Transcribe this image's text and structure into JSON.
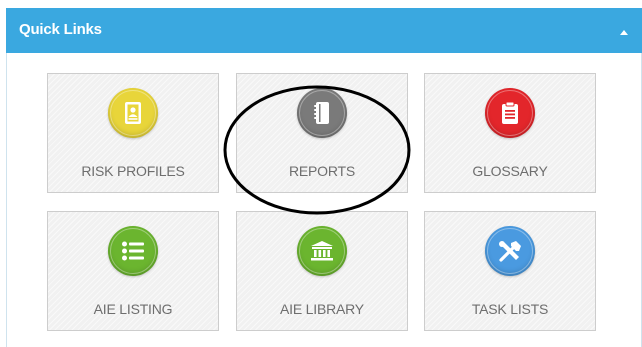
{
  "panel": {
    "title": "Quick Links",
    "collapse_icon": "chevron-up-icon"
  },
  "tiles": [
    {
      "label": "RISK PROFILES",
      "icon": "profile-card-icon",
      "color": "#e8d53a"
    },
    {
      "label": "REPORTS",
      "icon": "notebook-icon",
      "color": "#7a7a7a"
    },
    {
      "label": "GLOSSARY",
      "icon": "clipboard-icon",
      "color": "#e3262b"
    },
    {
      "label": "AIE LISTING",
      "icon": "list-icon",
      "color": "#6bb52f"
    },
    {
      "label": "AIE LIBRARY",
      "icon": "library-building-icon",
      "color": "#6bb52f"
    },
    {
      "label": "TASK LISTS",
      "icon": "tools-icon",
      "color": "#4a9ae0"
    }
  ],
  "colors": {
    "header": "#3aa8e0",
    "annotation": "#000000"
  }
}
